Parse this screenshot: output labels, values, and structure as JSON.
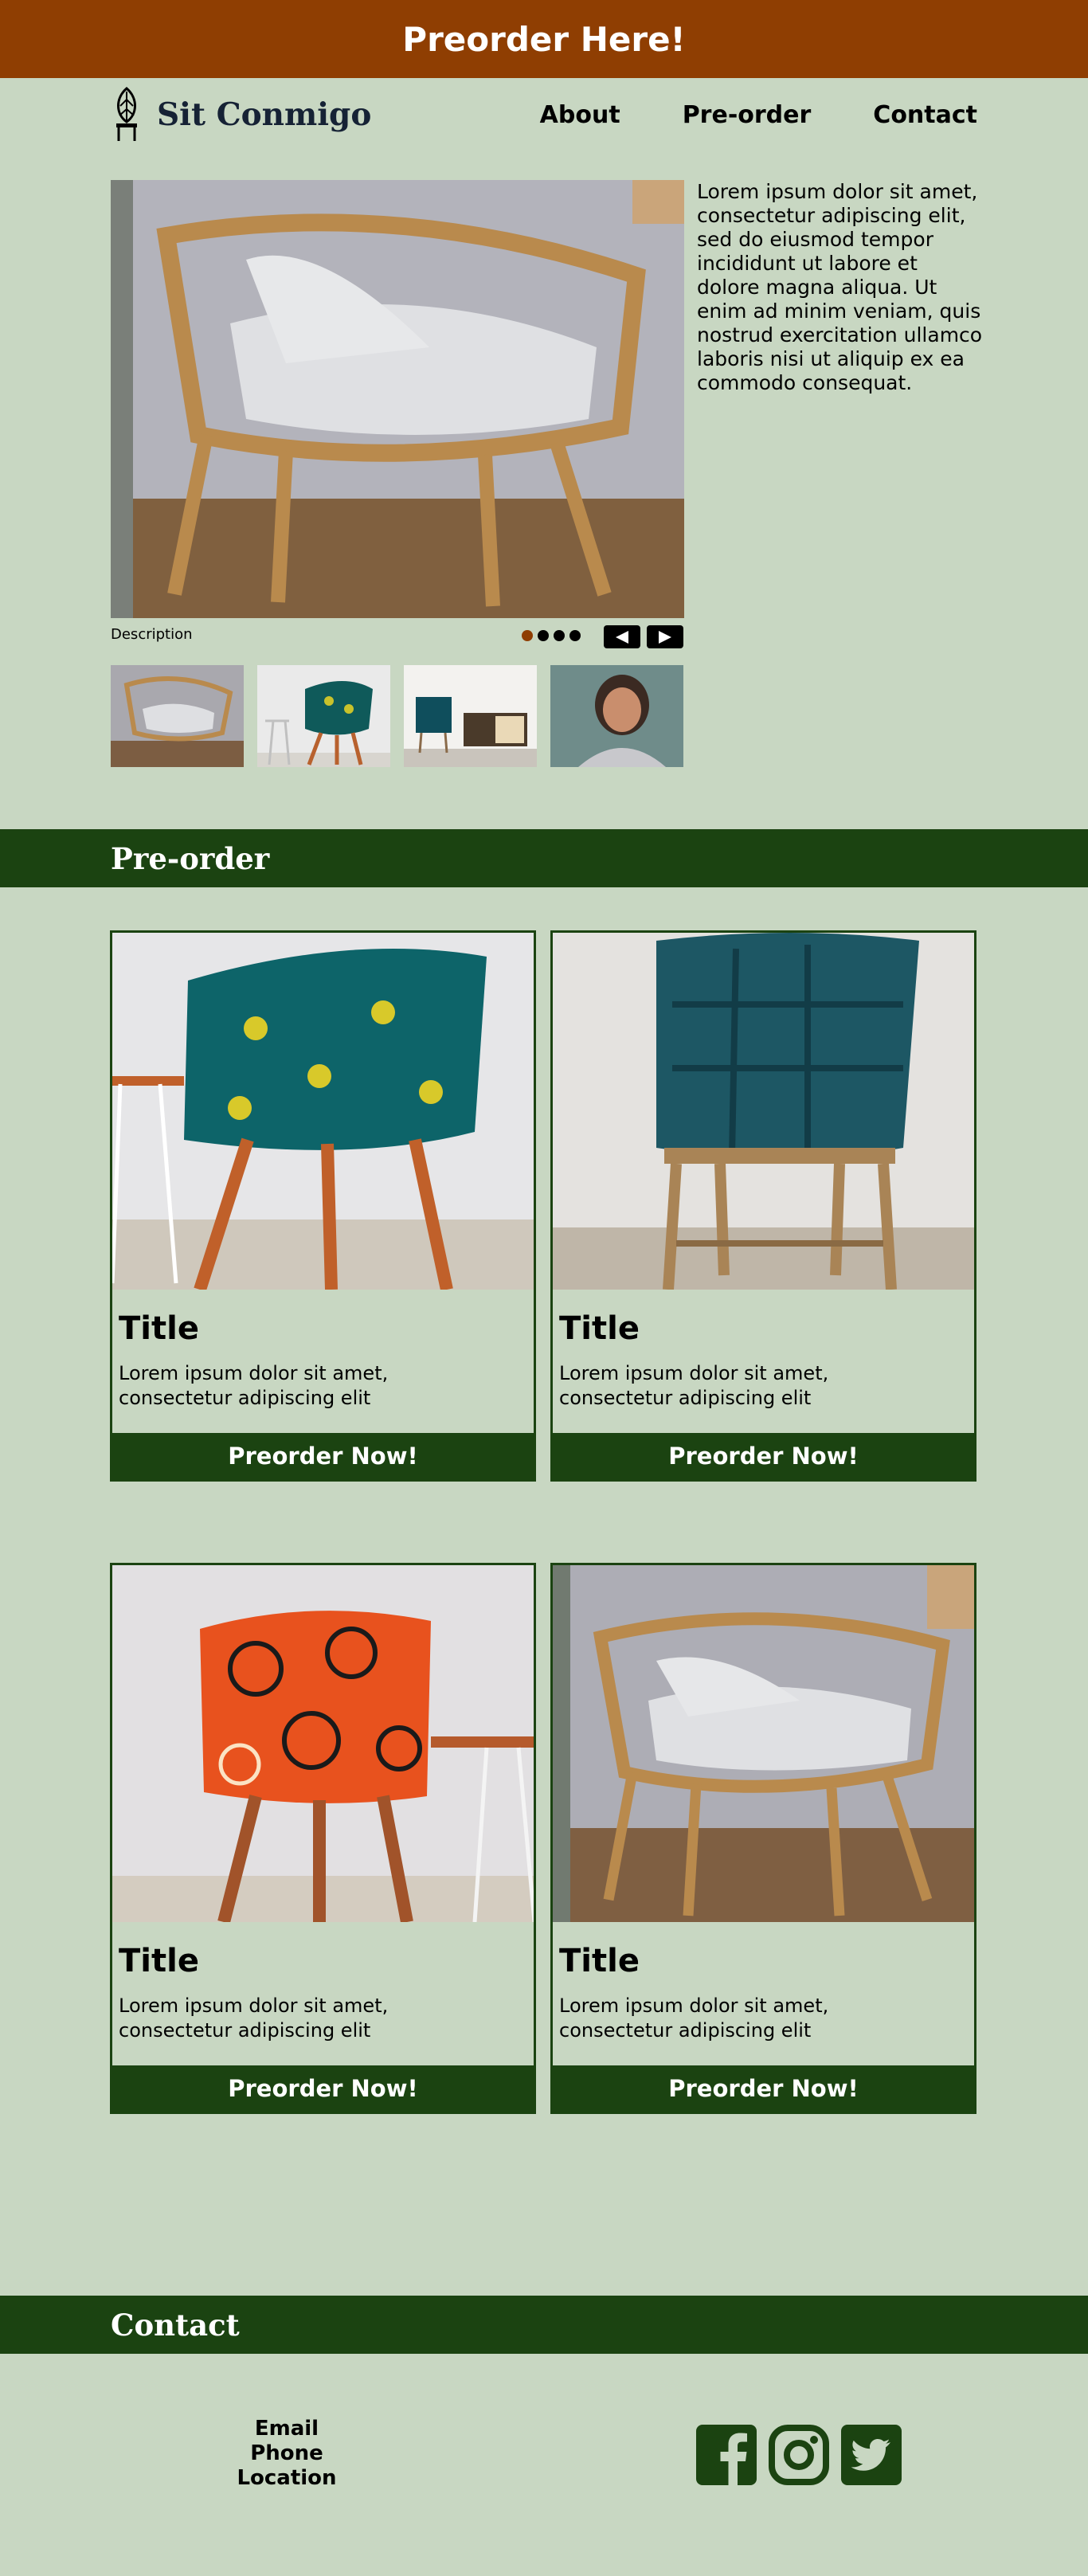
{
  "banner": {
    "text": "Preorder Here!"
  },
  "header": {
    "brand": "Sit Conmigo",
    "nav": [
      "About",
      "Pre-order",
      "Contact"
    ]
  },
  "hero": {
    "text": "Lorem ipsum dolor sit amet, consectetur adipiscing elit, sed do eiusmod tempor incididunt ut labore et dolore magna aliqua. Ut enim ad minim veniam, quis nostrud exercitation ullamco laboris nisi ut aliquip ex ea commodo consequat.",
    "caption": "Description",
    "carousel": {
      "slides": 4,
      "active": 1
    }
  },
  "preorder": {
    "heading": "Pre-order",
    "cards": [
      {
        "title": "Title",
        "text": "Lorem ipsum dolor sit amet, consectetur adipiscing elit",
        "button": "Preorder Now!"
      },
      {
        "title": "Title",
        "text": "Lorem ipsum dolor sit amet, consectetur adipiscing elit",
        "button": "Preorder Now!"
      },
      {
        "title": "Title",
        "text": "Lorem ipsum dolor sit amet, consectetur adipiscing elit",
        "button": "Preorder Now!"
      },
      {
        "title": "Title",
        "text": "Lorem ipsum dolor sit amet, consectetur adipiscing elit",
        "button": "Preorder Now!"
      }
    ]
  },
  "contact": {
    "heading": "Contact",
    "lines": [
      "Email",
      "Phone",
      "Location"
    ],
    "socials": [
      "facebook-icon",
      "instagram-icon",
      "twitter-icon"
    ]
  },
  "colors": {
    "background": "#c8d7c2",
    "banner": "#8f3e02",
    "green": "#1b4311",
    "brand_text": "#162235"
  }
}
